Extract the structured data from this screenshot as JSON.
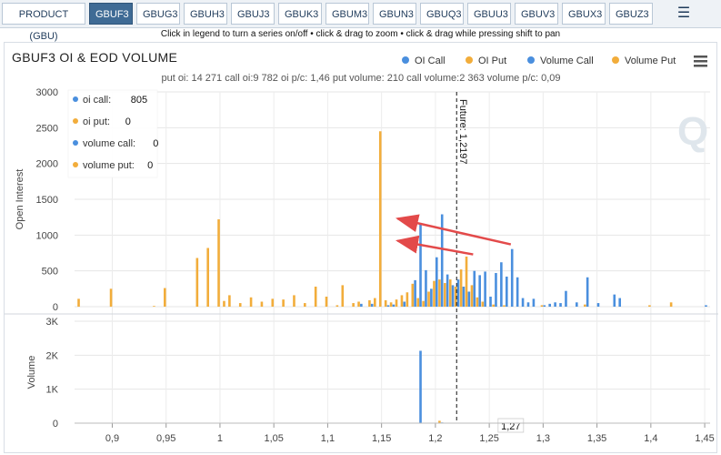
{
  "tabs": [
    "PRODUCT (GBU)",
    "GBUF3",
    "GBUG3",
    "GBUH3",
    "GBUJ3",
    "GBUK3",
    "GBUM3",
    "GBUN3",
    "GBUQ3",
    "GBUU3",
    "GBUV3",
    "GBUX3",
    "GBUZ3"
  ],
  "active_tab": "GBUF3",
  "menu_icon": "hamburger-icon",
  "instruction": "Click in legend to turn a series on/off • click & drag to zoom • click & drag while pressing shift to pan",
  "colors": {
    "call": "#4a8fde",
    "put": "#f2ad3b",
    "arrow": "#e34a4a",
    "tabActive": "#3f6b95"
  },
  "chart_data": {
    "type": "bar",
    "title": "GBUF3 OI & EOD VOLUME",
    "subtitle": "put oi: 14 271 call oi:9 782 oi p/c: 1,46 put volume: 210 call volume:2 363 volume p/c: 0,09",
    "legend": [
      "OI Call",
      "OI Put",
      "Volume Call",
      "Volume Put"
    ],
    "legend_position": "top-right",
    "tooltip": [
      {
        "label": "oi call:",
        "value": "805",
        "series": "call"
      },
      {
        "label": "oi put:",
        "value": "0",
        "series": "put"
      },
      {
        "label": "volume call:",
        "value": "0",
        "series": "call"
      },
      {
        "label": "volume put:",
        "value": "0",
        "series": "put"
      }
    ],
    "future_label": "Future: 1,2197",
    "future_price": 1.2197,
    "crosshair_label": "1,27",
    "crosshair_x": 1.27,
    "xlim": [
      0.865,
      1.455
    ],
    "x_ticks": [
      0.9,
      0.95,
      1,
      1.05,
      1.1,
      1.15,
      1.2,
      1.25,
      1.3,
      1.35,
      1.4,
      1.45
    ],
    "x_tick_labels": [
      "0,9",
      "0,95",
      "1",
      "1,05",
      "1,1",
      "1,15",
      "1,2",
      "1,25",
      "1,3",
      "1,35",
      "1,4",
      "1,45"
    ],
    "oi_axis": {
      "label": "Open Interest",
      "ylim": [
        0,
        3000
      ],
      "ticks": [
        0,
        500,
        1000,
        1500,
        2000,
        2500,
        3000
      ],
      "tick_labels": [
        "0",
        "500",
        "1000",
        "1500",
        "2000",
        "2500",
        "3000"
      ]
    },
    "volume_axis": {
      "label": "Volume",
      "ylim": [
        0,
        3000
      ],
      "ticks": [
        0,
        1000,
        2000,
        3000
      ],
      "tick_labels": [
        "0",
        "1K",
        "2K",
        "3K"
      ]
    },
    "oi_put": [
      [
        0.87,
        110
      ],
      [
        0.9,
        250
      ],
      [
        0.94,
        10
      ],
      [
        0.95,
        260
      ],
      [
        0.98,
        680
      ],
      [
        0.99,
        820
      ],
      [
        1.0,
        1220
      ],
      [
        1.005,
        80
      ],
      [
        1.01,
        160
      ],
      [
        1.02,
        50
      ],
      [
        1.03,
        130
      ],
      [
        1.04,
        70
      ],
      [
        1.05,
        110
      ],
      [
        1.06,
        100
      ],
      [
        1.07,
        160
      ],
      [
        1.08,
        50
      ],
      [
        1.09,
        280
      ],
      [
        1.1,
        140
      ],
      [
        1.11,
        20
      ],
      [
        1.115,
        300
      ],
      [
        1.125,
        50
      ],
      [
        1.13,
        70
      ],
      [
        1.14,
        90
      ],
      [
        1.145,
        120
      ],
      [
        1.15,
        2450
      ],
      [
        1.155,
        90
      ],
      [
        1.16,
        60
      ],
      [
        1.165,
        100
      ],
      [
        1.17,
        160
      ],
      [
        1.175,
        200
      ],
      [
        1.18,
        320
      ],
      [
        1.185,
        120
      ],
      [
        1.19,
        80
      ],
      [
        1.195,
        210
      ],
      [
        1.2,
        360
      ],
      [
        1.205,
        380
      ],
      [
        1.21,
        330
      ],
      [
        1.215,
        380
      ],
      [
        1.22,
        280
      ],
      [
        1.225,
        520
      ],
      [
        1.23,
        700
      ],
      [
        1.235,
        300
      ],
      [
        1.24,
        130
      ],
      [
        1.245,
        70
      ],
      [
        1.255,
        30
      ],
      [
        1.265,
        20
      ],
      [
        1.3,
        20
      ],
      [
        1.34,
        30
      ],
      [
        1.4,
        20
      ],
      [
        1.42,
        60
      ]
    ],
    "oi_call": [
      [
        1.13,
        40
      ],
      [
        1.14,
        40
      ],
      [
        1.155,
        20
      ],
      [
        1.16,
        30
      ],
      [
        1.17,
        70
      ],
      [
        1.18,
        370
      ],
      [
        1.185,
        1170
      ],
      [
        1.19,
        510
      ],
      [
        1.195,
        250
      ],
      [
        1.2,
        690
      ],
      [
        1.205,
        1290
      ],
      [
        1.21,
        450
      ],
      [
        1.215,
        300
      ],
      [
        1.22,
        380
      ],
      [
        1.225,
        280
      ],
      [
        1.23,
        210
      ],
      [
        1.235,
        500
      ],
      [
        1.24,
        440
      ],
      [
        1.245,
        490
      ],
      [
        1.25,
        140
      ],
      [
        1.255,
        470
      ],
      [
        1.26,
        620
      ],
      [
        1.265,
        420
      ],
      [
        1.27,
        805
      ],
      [
        1.275,
        410
      ],
      [
        1.28,
        120
      ],
      [
        1.285,
        60
      ],
      [
        1.29,
        110
      ],
      [
        1.3,
        20
      ],
      [
        1.305,
        40
      ],
      [
        1.31,
        60
      ],
      [
        1.315,
        50
      ],
      [
        1.32,
        220
      ],
      [
        1.33,
        60
      ],
      [
        1.34,
        410
      ],
      [
        1.35,
        50
      ],
      [
        1.365,
        170
      ],
      [
        1.37,
        120
      ],
      [
        1.45,
        20
      ]
    ],
    "volume_call": [
      [
        1.185,
        2130
      ],
      [
        1.205,
        20
      ]
    ],
    "volume_put": [
      [
        1.205,
        70
      ]
    ],
    "annotations": [
      {
        "type": "arrow",
        "from": [
          1.27,
          870
        ],
        "to": [
          1.165,
          1230
        ]
      },
      {
        "type": "arrow",
        "from": [
          1.235,
          730
        ],
        "to": [
          1.165,
          920
        ]
      }
    ]
  }
}
